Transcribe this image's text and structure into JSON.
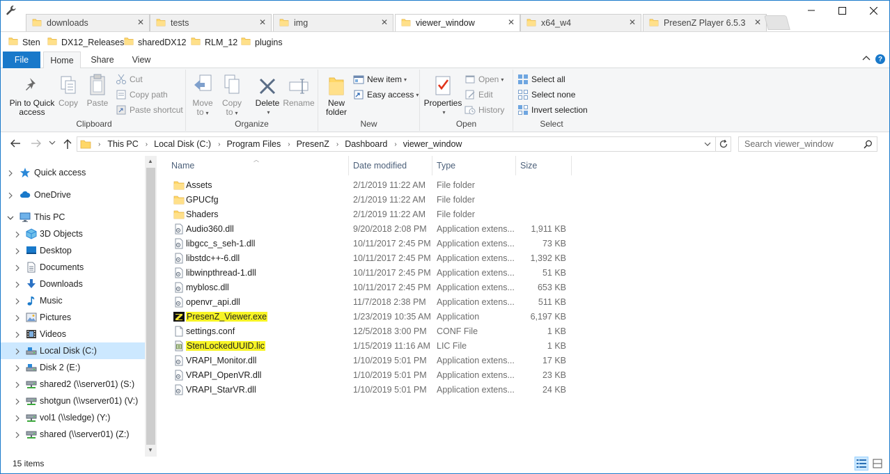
{
  "tabs": [
    {
      "label": "downloads"
    },
    {
      "label": "tests"
    },
    {
      "label": "img"
    },
    {
      "label": "viewer_window"
    },
    {
      "label": "x64_w4"
    },
    {
      "label": "PresenZ Player 6.5.3"
    }
  ],
  "favorites": [
    "Sten",
    "DX12_Releases",
    "sharedDX12",
    "RLM_12",
    "plugins"
  ],
  "ribbon_tabs": {
    "file": "File",
    "home": "Home",
    "share": "Share",
    "view": "View"
  },
  "ribbon": {
    "clipboard": {
      "label": "Clipboard",
      "pin_line1": "Pin to Quick",
      "pin_line2": "access",
      "copy": "Copy",
      "paste": "Paste",
      "cut": "Cut",
      "copy_path": "Copy path",
      "paste_shortcut": "Paste shortcut"
    },
    "organize": {
      "label": "Organize",
      "move_line1": "Move",
      "move_line2": "to",
      "copy_line1": "Copy",
      "copy_line2": "to",
      "delete": "Delete",
      "rename": "Rename"
    },
    "new": {
      "label": "New",
      "folder_line1": "New",
      "folder_line2": "folder",
      "new_item": "New item",
      "easy_access": "Easy access"
    },
    "open": {
      "label": "Open",
      "properties": "Properties",
      "open": "Open",
      "edit": "Edit",
      "history": "History"
    },
    "select": {
      "label": "Select",
      "select_all": "Select all",
      "select_none": "Select none",
      "invert_selection": "Invert selection"
    }
  },
  "breadcrumb": [
    "This PC",
    "Local Disk (C:)",
    "Program Files",
    "PresenZ",
    "Dashboard",
    "viewer_window"
  ],
  "search": {
    "placeholder": "Search viewer_window"
  },
  "nav": [
    {
      "label": "Quick access",
      "icon": "star-icon",
      "level": 0
    },
    {
      "label": "OneDrive",
      "icon": "cloud-icon",
      "level": 0
    },
    {
      "label": "This PC",
      "icon": "computer-icon",
      "level": 0,
      "expanded": true
    },
    {
      "label": "3D Objects",
      "icon": "cube-icon",
      "level": 1
    },
    {
      "label": "Desktop",
      "icon": "desktop-icon",
      "level": 1
    },
    {
      "label": "Documents",
      "icon": "document-icon",
      "level": 1
    },
    {
      "label": "Downloads",
      "icon": "download-icon",
      "level": 1
    },
    {
      "label": "Music",
      "icon": "music-icon",
      "level": 1
    },
    {
      "label": "Pictures",
      "icon": "picture-icon",
      "level": 1
    },
    {
      "label": "Videos",
      "icon": "video-icon",
      "level": 1
    },
    {
      "label": "Local Disk (C:)",
      "icon": "drive-icon",
      "level": 1,
      "selected": true
    },
    {
      "label": "Disk 2 (E:)",
      "icon": "drive-icon",
      "level": 1
    },
    {
      "label": "shared2 (\\\\server01) (S:)",
      "icon": "network-drive-icon",
      "level": 1
    },
    {
      "label": "shotgun (\\\\vserver01) (V:)",
      "icon": "network-drive-icon",
      "level": 1
    },
    {
      "label": "vol1 (\\\\sledge) (Y:)",
      "icon": "network-drive-icon",
      "level": 1
    },
    {
      "label": "shared (\\\\server01) (Z:)",
      "icon": "network-drive-icon",
      "level": 1
    }
  ],
  "columns": {
    "name": "Name",
    "date": "Date modified",
    "type": "Type",
    "size": "Size"
  },
  "files": [
    {
      "name": "Assets",
      "date": "2/1/2019 11:22 AM",
      "type": "File folder",
      "size": "",
      "icon": "folder"
    },
    {
      "name": "GPUCfg",
      "date": "2/1/2019 11:22 AM",
      "type": "File folder",
      "size": "",
      "icon": "folder"
    },
    {
      "name": "Shaders",
      "date": "2/1/2019 11:22 AM",
      "type": "File folder",
      "size": "",
      "icon": "folder"
    },
    {
      "name": "Audio360.dll",
      "date": "9/20/2018 2:08 PM",
      "type": "Application extens...",
      "size": "1,911 KB",
      "icon": "dll"
    },
    {
      "name": "libgcc_s_seh-1.dll",
      "date": "10/11/2017 2:45 PM",
      "type": "Application extens...",
      "size": "73 KB",
      "icon": "dll"
    },
    {
      "name": "libstdc++-6.dll",
      "date": "10/11/2017 2:45 PM",
      "type": "Application extens...",
      "size": "1,392 KB",
      "icon": "dll"
    },
    {
      "name": "libwinpthread-1.dll",
      "date": "10/11/2017 2:45 PM",
      "type": "Application extens...",
      "size": "51 KB",
      "icon": "dll"
    },
    {
      "name": "myblosc.dll",
      "date": "10/11/2017 2:45 PM",
      "type": "Application extens...",
      "size": "653 KB",
      "icon": "dll"
    },
    {
      "name": "openvr_api.dll",
      "date": "11/7/2018 2:38 PM",
      "type": "Application extens...",
      "size": "511 KB",
      "icon": "dll"
    },
    {
      "name": "PresenZ_Viewer.exe",
      "date": "1/23/2019 10:35 AM",
      "type": "Application",
      "size": "6,197 KB",
      "icon": "exe",
      "highlight": true
    },
    {
      "name": "settings.conf",
      "date": "12/5/2018 3:00 PM",
      "type": "CONF File",
      "size": "1 KB",
      "icon": "file"
    },
    {
      "name": "StenLockedUUID.lic",
      "date": "1/15/2019 11:16 AM",
      "type": "LIC File",
      "size": "1 KB",
      "icon": "lic",
      "highlight": true
    },
    {
      "name": "VRAPI_Monitor.dll",
      "date": "1/10/2019 5:01 PM",
      "type": "Application extens...",
      "size": "17 KB",
      "icon": "dll"
    },
    {
      "name": "VRAPI_OpenVR.dll",
      "date": "1/10/2019 5:01 PM",
      "type": "Application extens...",
      "size": "23 KB",
      "icon": "dll"
    },
    {
      "name": "VRAPI_StarVR.dll",
      "date": "1/10/2019 5:01 PM",
      "type": "Application extens...",
      "size": "24 KB",
      "icon": "dll"
    }
  ],
  "status": {
    "count": "15 items"
  },
  "colors": {
    "accent": "#1979ca",
    "selection": "#cce8ff",
    "highlight": "#f7f425",
    "folder": "#ffd767"
  }
}
